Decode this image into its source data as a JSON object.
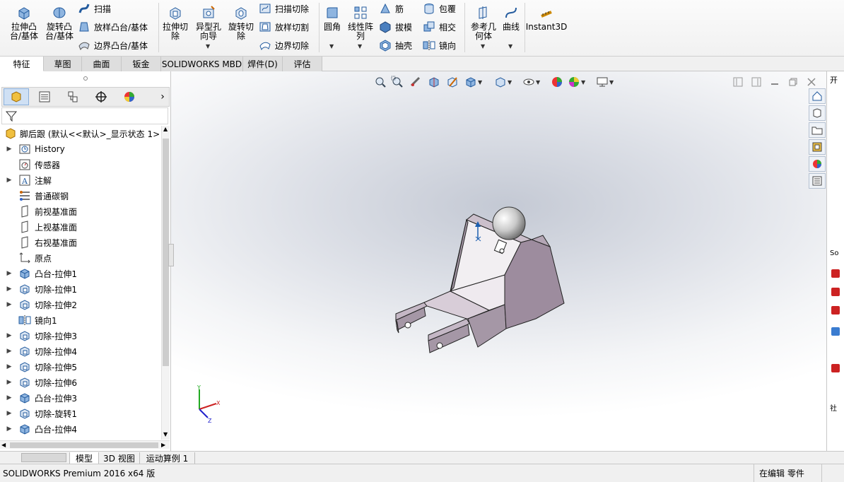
{
  "ribbon": {
    "extrude_boss": "拉伸凸\n台/基体",
    "revolve_boss": "旋转凸\n台/基体",
    "sweep": "扫描",
    "loft": "放样凸台/基体",
    "boundary_boss": "边界凸台/基体",
    "extrude_cut": "拉伸切\n除",
    "hole_wizard": "异型孔\n向导",
    "revolve_cut": "旋转切\n除",
    "sweep_cut": "扫描切除",
    "loft_cut": "放样切割",
    "boundary_cut": "边界切除",
    "fillet": "圆角",
    "linear_pattern": "线性阵\n列",
    "rib": "筋",
    "draft": "拔模",
    "shell": "抽壳",
    "wrap": "包覆",
    "intersect": "相交",
    "mirror": "镜向",
    "ref_geometry": "参考几\n何体",
    "curves": "曲线",
    "instant3d": "Instant3D"
  },
  "tabs": [
    "特征",
    "草图",
    "曲面",
    "钣金",
    "SOLIDWORKS MBD",
    "焊件(D)",
    "评估"
  ],
  "tree": {
    "root": "脚后跟 (默认<<默认>_显示状态 1>",
    "items": [
      {
        "label": "History",
        "icon": "history-icon",
        "exp": true
      },
      {
        "label": "传感器",
        "icon": "sensor-icon",
        "exp": false
      },
      {
        "label": "注解",
        "icon": "annotation-icon",
        "exp": true
      },
      {
        "label": "普通碳钢",
        "icon": "material-icon",
        "exp": false
      },
      {
        "label": "前视基准面",
        "icon": "plane-icon",
        "exp": false
      },
      {
        "label": "上视基准面",
        "icon": "plane-icon",
        "exp": false
      },
      {
        "label": "右视基准面",
        "icon": "plane-icon",
        "exp": false
      },
      {
        "label": "原点",
        "icon": "origin-icon",
        "exp": false
      },
      {
        "label": "凸台-拉伸1",
        "icon": "boss-icon",
        "exp": true
      },
      {
        "label": "切除-拉伸1",
        "icon": "cut-icon",
        "exp": true
      },
      {
        "label": "切除-拉伸2",
        "icon": "cut-icon",
        "exp": true
      },
      {
        "label": "镜向1",
        "icon": "mirror-icon",
        "exp": false
      },
      {
        "label": "切除-拉伸3",
        "icon": "cut-icon",
        "exp": true
      },
      {
        "label": "切除-拉伸4",
        "icon": "cut-icon",
        "exp": true
      },
      {
        "label": "切除-拉伸5",
        "icon": "cut-icon",
        "exp": true
      },
      {
        "label": "切除-拉伸6",
        "icon": "cut-icon",
        "exp": true
      },
      {
        "label": "凸台-拉伸3",
        "icon": "boss-icon",
        "exp": true
      },
      {
        "label": "切除-旋转1",
        "icon": "cut-icon",
        "exp": true
      },
      {
        "label": "凸台-拉伸4",
        "icon": "boss-icon",
        "exp": true
      }
    ]
  },
  "bottom_tabs": [
    "模型",
    "3D 视图",
    "运动算例 1"
  ],
  "status": {
    "left": "SOLIDWORKS Premium 2016 x64 版",
    "right": "在编辑 零件"
  },
  "right_panel": {
    "label1": "开",
    "label2": "So",
    "label3": "社"
  },
  "colors": {
    "part": "#9d8c9e",
    "accent": "#1c5fb0"
  }
}
